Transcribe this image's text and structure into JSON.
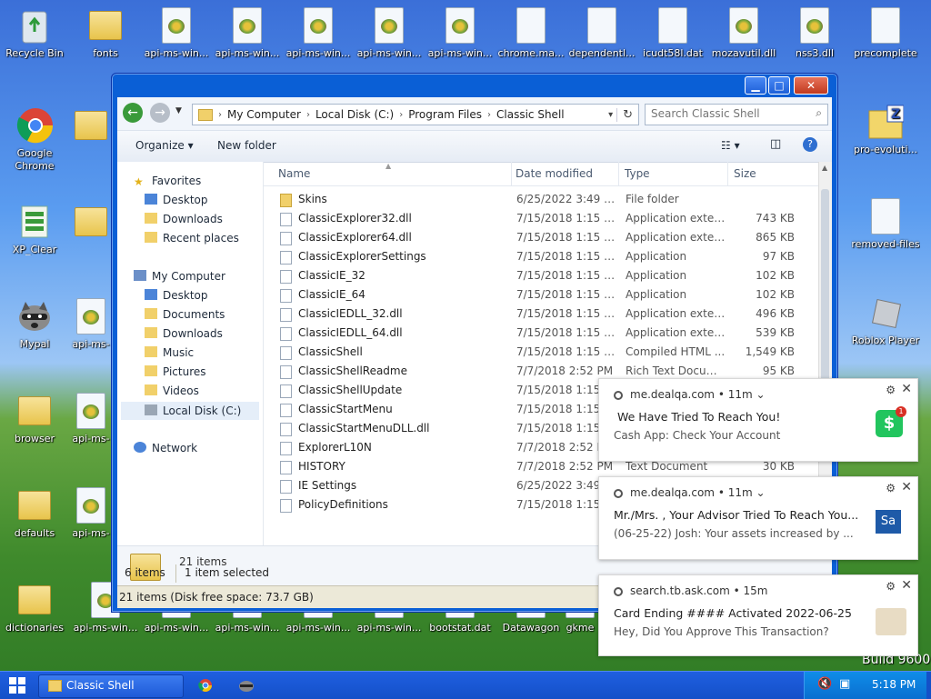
{
  "desktop": {
    "top_row": [
      "Recycle Bin",
      "fonts",
      "api-ms-win...",
      "api-ms-win...",
      "api-ms-win...",
      "api-ms-win...",
      "api-ms-win...",
      "chrome.ma...",
      "dependentl...",
      "icudt58l.dat",
      "mozavutil.dll",
      "nss3.dll",
      "precomplete"
    ],
    "left_col": [
      "Google Chrome",
      "XP_Clear",
      "Mypal",
      "browser",
      "defaults",
      "dictionaries"
    ],
    "left_col2": [
      "api-ms-",
      "api-ms-",
      "api-ms-"
    ],
    "bottom_row": [
      "api-ms-win...",
      "api-ms-win...",
      "api-ms-win...",
      "api-ms-win...",
      "api-ms-win...",
      "bootstat.dat",
      "Datawagon",
      "gkme"
    ],
    "right_col": [
      "pro-evoluti...",
      "removed-files",
      "Roblox Player"
    ],
    "build_text": "Build 9600"
  },
  "explorer": {
    "address": {
      "segments": [
        "My Computer",
        "Local Disk (C:)",
        "Program Files",
        "Classic Shell"
      ]
    },
    "search_placeholder": "Search Classic Shell",
    "toolbar": {
      "organize": "Organize ▾",
      "new_folder": "New folder"
    },
    "nav": {
      "favorites": "Favorites",
      "fav_items": [
        "Desktop",
        "Downloads",
        "Recent places"
      ],
      "my_computer": "My Computer",
      "mc_items": [
        "Desktop",
        "Documents",
        "Downloads",
        "Music",
        "Pictures",
        "Videos",
        "Local Disk (C:)"
      ],
      "network": "Network"
    },
    "columns": {
      "name": "Name",
      "date": "Date modified",
      "type": "Type",
      "size": "Size"
    },
    "files": [
      {
        "name": "Skins",
        "date": "6/25/2022 3:49 PM",
        "type": "File folder",
        "size": "",
        "folder": true
      },
      {
        "name": "ClassicExplorer32.dll",
        "date": "7/15/2018 1:15 PM",
        "type": "Application extens...",
        "size": "743 KB"
      },
      {
        "name": "ClassicExplorer64.dll",
        "date": "7/15/2018 1:15 PM",
        "type": "Application extens...",
        "size": "865 KB"
      },
      {
        "name": "ClassicExplorerSettings",
        "date": "7/15/2018 1:15 PM",
        "type": "Application",
        "size": "97 KB"
      },
      {
        "name": "ClassicIE_32",
        "date": "7/15/2018 1:15 PM",
        "type": "Application",
        "size": "102 KB"
      },
      {
        "name": "ClassicIE_64",
        "date": "7/15/2018 1:15 PM",
        "type": "Application",
        "size": "102 KB"
      },
      {
        "name": "ClassicIEDLL_32.dll",
        "date": "7/15/2018 1:15 PM",
        "type": "Application extens...",
        "size": "496 KB"
      },
      {
        "name": "ClassicIEDLL_64.dll",
        "date": "7/15/2018 1:15 PM",
        "type": "Application extens...",
        "size": "539 KB"
      },
      {
        "name": "ClassicShell",
        "date": "7/15/2018 1:15 PM",
        "type": "Compiled HTML ...",
        "size": "1,549 KB"
      },
      {
        "name": "ClassicShellReadme",
        "date": "7/7/2018 2:52 PM",
        "type": "Rich Text Docume...",
        "size": "95 KB"
      },
      {
        "name": "ClassicShellUpdate",
        "date": "7/15/2018 1:15 PM",
        "type": "",
        "size": ""
      },
      {
        "name": "ClassicStartMenu",
        "date": "7/15/2018 1:15 PM",
        "type": "",
        "size": ""
      },
      {
        "name": "ClassicStartMenuDLL.dll",
        "date": "7/15/2018 1:15 PM",
        "type": "",
        "size": ""
      },
      {
        "name": "ExplorerL10N",
        "date": "7/7/2018 2:52 PM",
        "type": "",
        "size": ""
      },
      {
        "name": "HISTORY",
        "date": "7/7/2018 2:52 PM",
        "type": "Text Document",
        "size": "30 KB"
      },
      {
        "name": "IE Settings",
        "date": "6/25/2022 3:49 PM",
        "type": "",
        "size": ""
      },
      {
        "name": "PolicyDefinitions",
        "date": "7/15/2018 1:15 PM",
        "type": "",
        "size": ""
      }
    ],
    "details_count": "21 items",
    "status": {
      "left": "6 items",
      "mid": "1 item selected",
      "bottom": "21 items (Disk free space: 73.7 GB)"
    }
  },
  "notifications": [
    {
      "source": "me.dealqa.com",
      "time": "11m",
      "title": "We Have Tried To Reach You!",
      "body": "Cash App:  Check Your Account",
      "badge": "1"
    },
    {
      "source": "me.dealqa.com",
      "time": "11m",
      "title": "Mr./Mrs. , Your Advisor Tried To Reach You...",
      "body": "(06-25-22) Josh: Your assets increased by ..."
    },
    {
      "source": "search.tb.ask.com",
      "time": "15m",
      "title": "Card Ending #### Activated 2022-06-25",
      "body": "Hey, Did You Approve This Transaction?"
    }
  ],
  "taskbar": {
    "active_window": "Classic Shell",
    "clock": "5:18 PM"
  }
}
